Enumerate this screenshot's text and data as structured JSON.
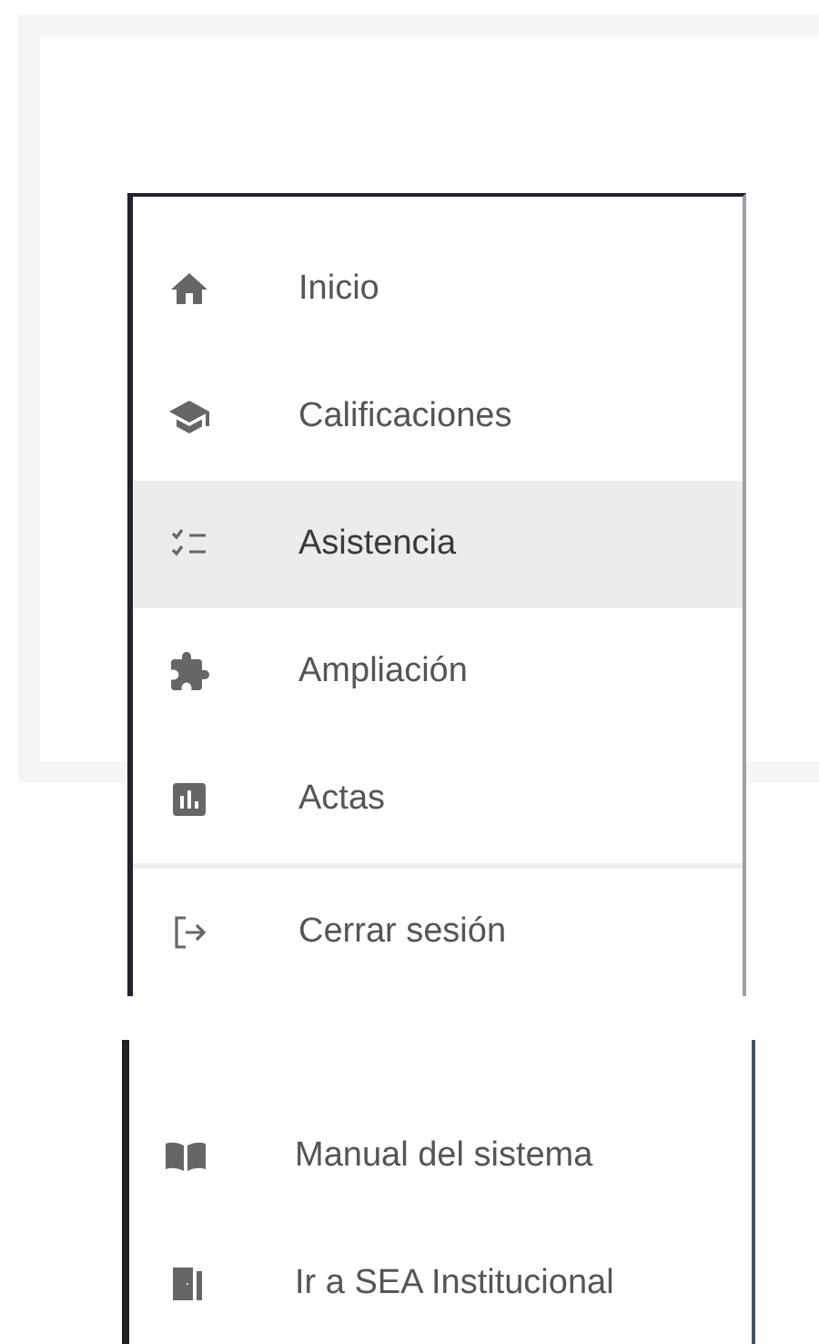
{
  "menu": {
    "sections": [
      {
        "items": [
          {
            "label": "Inicio",
            "selected": false
          },
          {
            "label": "Calificaciones",
            "selected": false
          },
          {
            "label": "Asistencia",
            "selected": true
          },
          {
            "label": "Ampliación",
            "selected": false
          },
          {
            "label": "Actas",
            "selected": false
          }
        ]
      },
      {
        "items": [
          {
            "label": "Cerrar sesión",
            "selected": false
          }
        ]
      }
    ]
  },
  "links": [
    {
      "label": "Manual del sistema"
    },
    {
      "label": "Ir a SEA Institucional"
    }
  ]
}
